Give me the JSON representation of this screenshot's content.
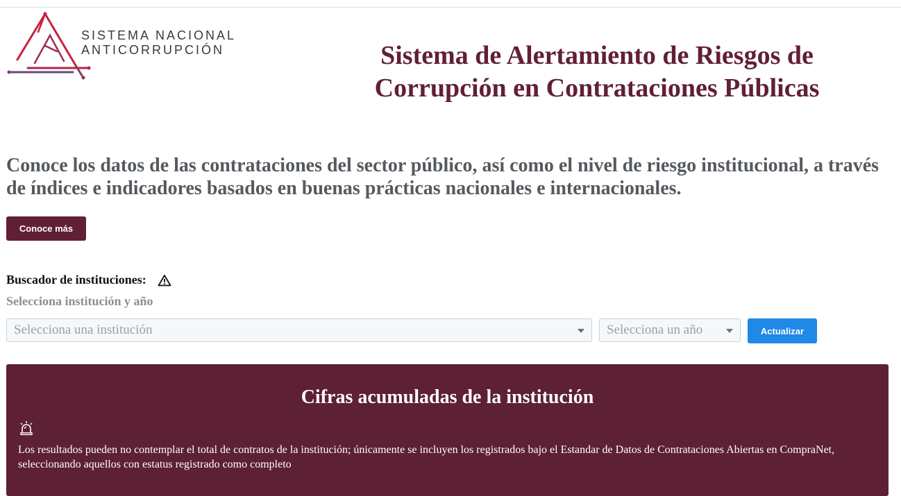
{
  "header": {
    "logo": {
      "line1": "SISTEMA NACIONAL",
      "line2": "ANTICORRUPCIÓN",
      "colors": [
        "#c8203f",
        "#8c3a57",
        "#6a4a73"
      ]
    },
    "title": "Sistema de Alertamiento de Riesgos de Corrupción en Contrataciones Públicas"
  },
  "intro": {
    "text": "Conoce los datos de las contrataciones del sector público, así como el nivel de riesgo institucional, a través de índices e indicadores basados en buenas prácticas nacionales e internacionales.",
    "button_label": "Conoce más"
  },
  "search": {
    "label": "Buscador de instituciones:",
    "label_icon": "warning-triangle-icon",
    "sublabel": "Selecciona institución y año",
    "institution_placeholder": "Selecciona una institución",
    "year_placeholder": "Selecciona un año",
    "update_label": "Actualizar"
  },
  "panel": {
    "title": "Cifras acumuladas de la institución",
    "icon": "alarm-siren-icon",
    "note": "Los resultados pueden no contemplar el total de contratos de la institución; únicamente se incluyen los registrados bajo el Estandar de Datos de Contrataciones Abiertas en CompraNet, seleccionando aquellos con estatus registrado como completo"
  },
  "colors": {
    "brand": "#611f35",
    "panel_bg": "#5d2034",
    "accent_blue": "#2088e6",
    "lead_text": "#555a5f"
  }
}
